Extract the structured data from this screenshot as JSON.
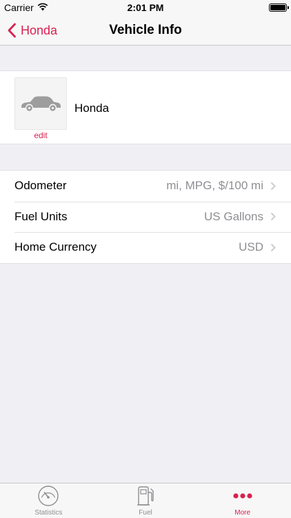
{
  "status_bar": {
    "carrier": "Carrier",
    "time": "2:01 PM"
  },
  "nav": {
    "back_label": "Honda",
    "title": "Vehicle Info"
  },
  "vehicle": {
    "name": "Honda",
    "photo_icon": "car-icon",
    "edit_label": "edit"
  },
  "settings": [
    {
      "label": "Odometer",
      "value": "mi, MPG, $/100 mi"
    },
    {
      "label": "Fuel Units",
      "value": "US Gallons"
    },
    {
      "label": "Home Currency",
      "value": "USD"
    }
  ],
  "tabs": [
    {
      "label": "Statistics",
      "icon": "speedometer-icon",
      "active": false
    },
    {
      "label": "Fuel",
      "icon": "fuel-pump-icon",
      "active": false
    },
    {
      "label": "More",
      "icon": "more-dots-icon",
      "active": true
    }
  ],
  "colors": {
    "accent": "#d9214f",
    "background": "#efeff4",
    "secondary_text": "#8e8e93"
  }
}
